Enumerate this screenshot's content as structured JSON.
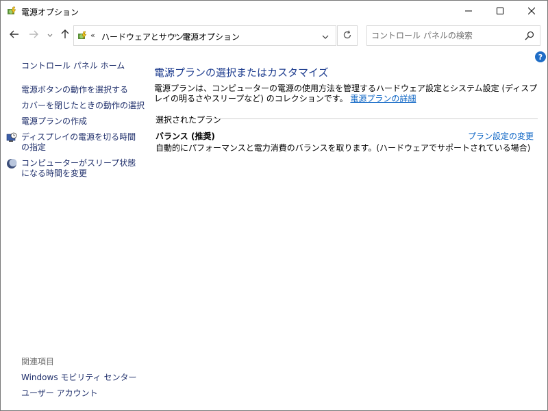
{
  "window": {
    "title": "電源オプション"
  },
  "nav": {
    "breadcrumb_prefix": "«",
    "breadcrumb_1": "ハードウェアとサウンド",
    "breadcrumb_sep": "›",
    "breadcrumb_2": "電源オプション",
    "search_placeholder": "コントロール パネルの検索"
  },
  "help_glyph": "?",
  "left": {
    "home": "コントロール パネル ホーム",
    "links": [
      "電源ボタンの動作を選択する",
      "カバーを閉じたときの動作の選択",
      "電源プランの作成",
      "ディスプレイの電源を切る時間の指定",
      "コンピューターがスリープ状態になる時間を変更"
    ],
    "related_title": "関連項目",
    "related": [
      "Windows モビリティ センター",
      "ユーザー アカウント"
    ]
  },
  "main": {
    "heading": "電源プランの選択またはカスタマイズ",
    "desc_text": "電源プランは、コンピューターの電源の使用方法を管理するハードウェア設定とシステム設定 (ディスプレイの明るさやスリープなど) のコレクションです。",
    "desc_link": "電源プランの詳細",
    "group_title": "選択されたプラン",
    "plan_name": "バランス (推奨)",
    "plan_desc": "自動的にパフォーマンスと電力消費のバランスを取ります。(ハードウェアでサポートされている場合)",
    "plan_link": "プラン設定の変更"
  },
  "colors": {
    "link": "#0a63c4",
    "heading": "#1e3d8f",
    "nav_link": "#1f2f6b",
    "help_bg": "#1f6dc6"
  },
  "icons": {
    "app": "power-options-icon",
    "back": "arrow-left-icon",
    "forward": "arrow-right-icon",
    "recent": "chevron-down-icon",
    "up": "arrow-up-icon",
    "refresh": "refresh-icon",
    "search": "search-icon",
    "display_timer": "display-clock-icon",
    "sleep": "moon-icon"
  }
}
